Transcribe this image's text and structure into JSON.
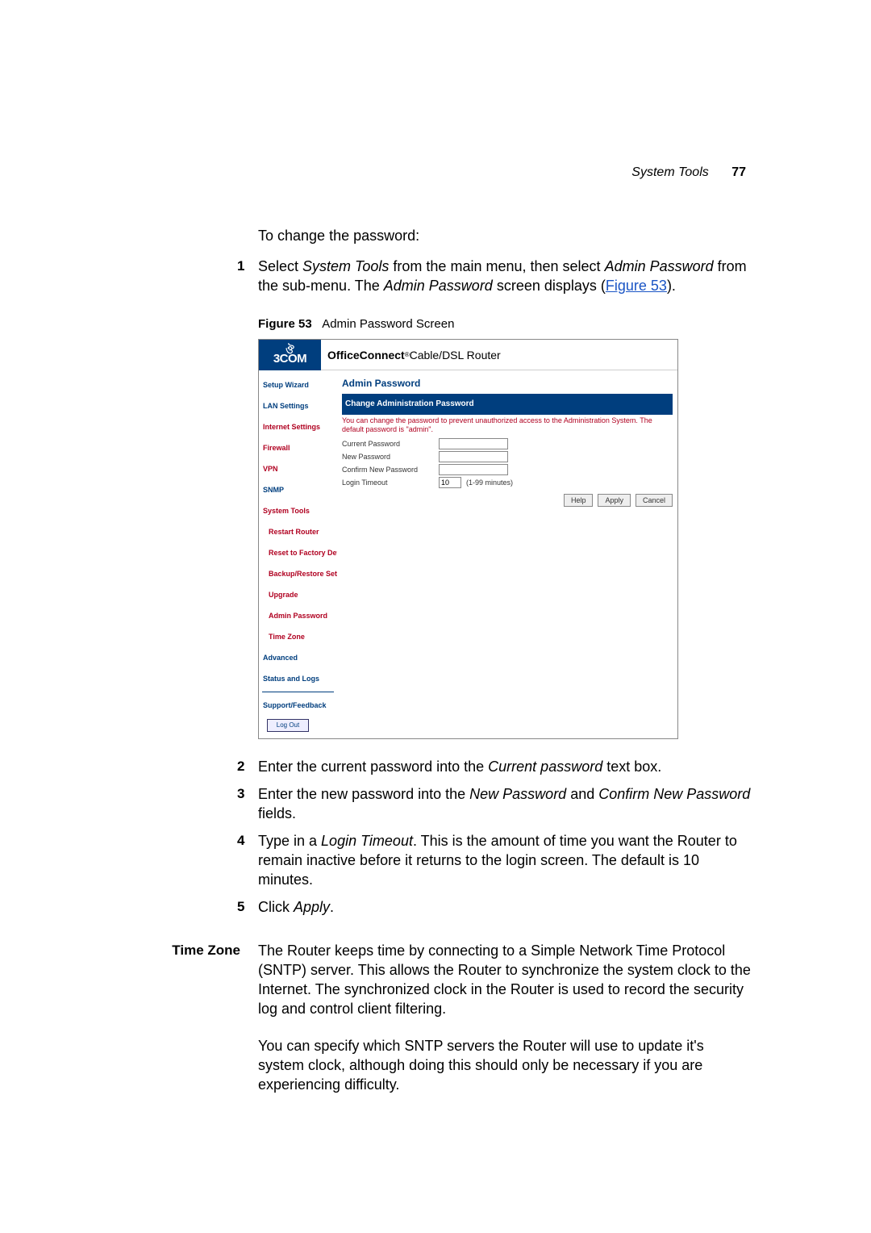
{
  "header": {
    "section": "System Tools",
    "page_number": "77"
  },
  "intro": {
    "line": "To change the password:"
  },
  "steps": {
    "s1_a": "Select ",
    "s1_b": "System Tools",
    "s1_c": " from the main menu, then select ",
    "s1_d": "Admin Password",
    "s1_e": " from the sub-menu. The ",
    "s1_f": "Admin Password",
    "s1_g": " screen displays (",
    "s1_link": "Figure 53",
    "s1_h": ").",
    "s2_a": "Enter the current password into the ",
    "s2_b": "Current password",
    "s2_c": " text box.",
    "s3_a": "Enter the new password into the ",
    "s3_b": "New Password",
    "s3_c": " and ",
    "s3_d": "Confirm New Password",
    "s3_e": " fields.",
    "s4_a": "Type in a ",
    "s4_b": "Login Timeout",
    "s4_c": ". This is the amount of time you want the Router to remain inactive before it returns to the login screen. The default is 10 minutes.",
    "s5_a": "Click ",
    "s5_b": "Apply",
    "s5_c": "."
  },
  "figure": {
    "caption_label": "Figure 53",
    "caption_text": "Admin Password Screen",
    "brand": "3COM",
    "product_a": "OfficeConnect",
    "product_b": " Cable/DSL Router",
    "nav": {
      "setup_wizard": "Setup Wizard",
      "lan_settings": "LAN Settings",
      "internet_settings": "Internet Settings",
      "firewall": "Firewall",
      "vpn": "VPN",
      "snmp": "SNMP",
      "system_tools": "System Tools",
      "restart_router": "Restart Router",
      "reset_defaults": "Reset to Factory Defaults",
      "backup_restore": "Backup/Restore Settings",
      "upgrade": "Upgrade",
      "admin_password": "Admin Password",
      "time_zone": "Time Zone",
      "advanced": "Advanced",
      "status_logs": "Status and Logs",
      "support": "Support/Feedback",
      "logout": "Log Out"
    },
    "panel": {
      "title": "Admin Password",
      "bar": "Change Administration Password",
      "note": "You can change the password to prevent unauthorized access to the Administration System. The default password is \"admin\".",
      "lbl_current": "Current Password",
      "lbl_new": "New Password",
      "lbl_confirm": "Confirm New Password",
      "lbl_timeout": "Login Timeout",
      "timeout_value": "10",
      "timeout_hint": "(1-99 minutes)",
      "btn_help": "Help",
      "btn_apply": "Apply",
      "btn_cancel": "Cancel"
    }
  },
  "timezone": {
    "heading": "Time Zone",
    "p1": "The Router keeps time by connecting to a Simple Network Time Protocol (SNTP) server. This allows the Router to synchronize the system clock to the Internet. The synchronized clock in the Router is used to record the security log and control client filtering.",
    "p2": "You can specify which SNTP servers the Router will use to update it's system clock, although doing this should only be necessary if you are experiencing difficulty."
  }
}
